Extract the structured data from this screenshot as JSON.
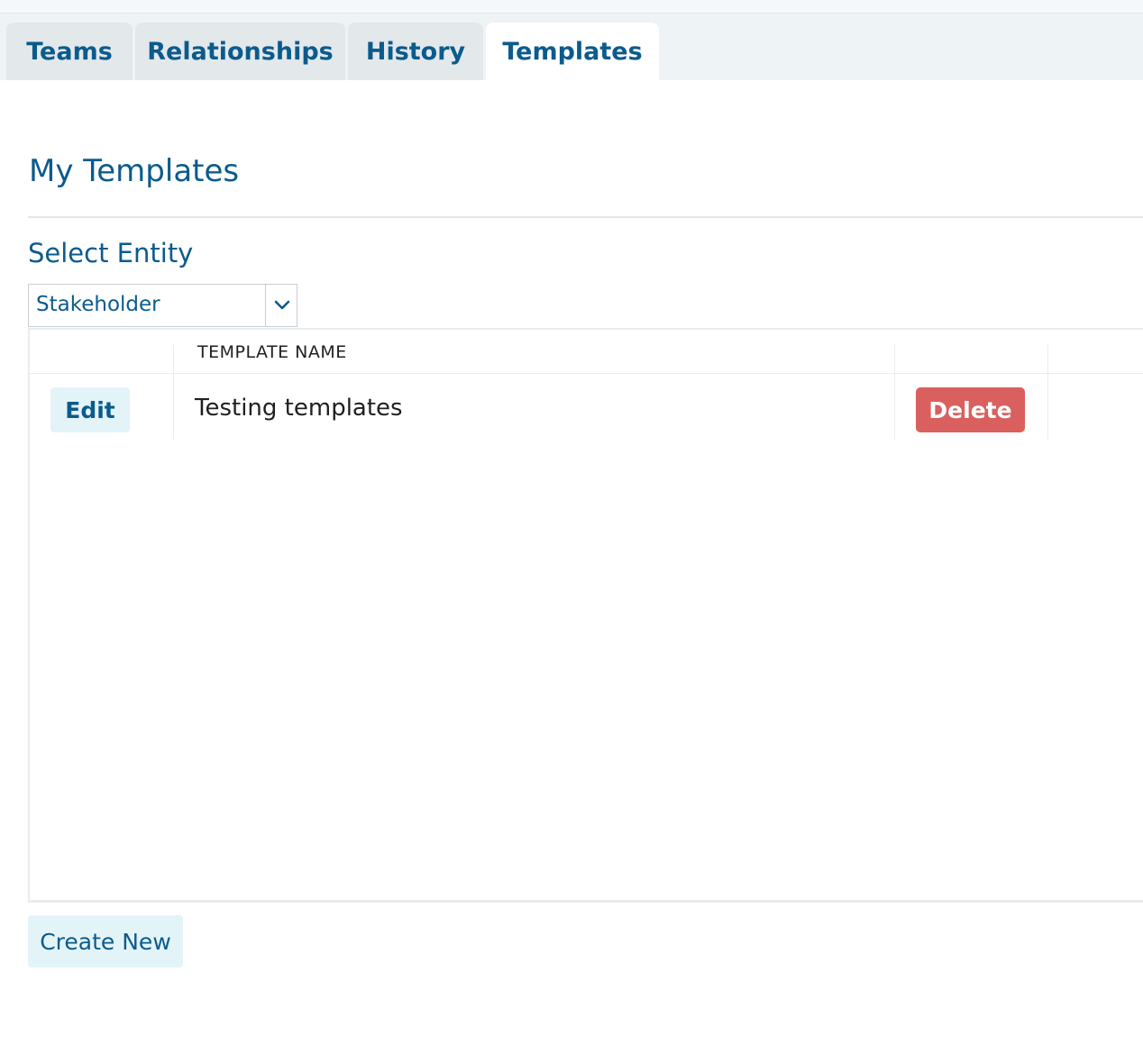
{
  "tabs": [
    {
      "label": "Teams",
      "active": false
    },
    {
      "label": "Relationships",
      "active": false
    },
    {
      "label": "History",
      "active": false
    },
    {
      "label": "Templates",
      "active": true
    }
  ],
  "page": {
    "title": "My Templates"
  },
  "entity_select": {
    "label": "Select Entity",
    "selected": "Stakeholder",
    "icon": "chevron-down-icon"
  },
  "table": {
    "columns": [
      "",
      "TEMPLATE NAME",
      "",
      ""
    ],
    "rows": [
      {
        "edit_label": "Edit",
        "name": "Testing templates",
        "delete_label": "Delete"
      }
    ]
  },
  "footer": {
    "create_label": "Create New"
  },
  "colors": {
    "brand_blue": "#0b5b8c",
    "button_light": "#e3f4f8",
    "danger": "#d9605f",
    "tab_inactive": "#e3e8eb"
  }
}
